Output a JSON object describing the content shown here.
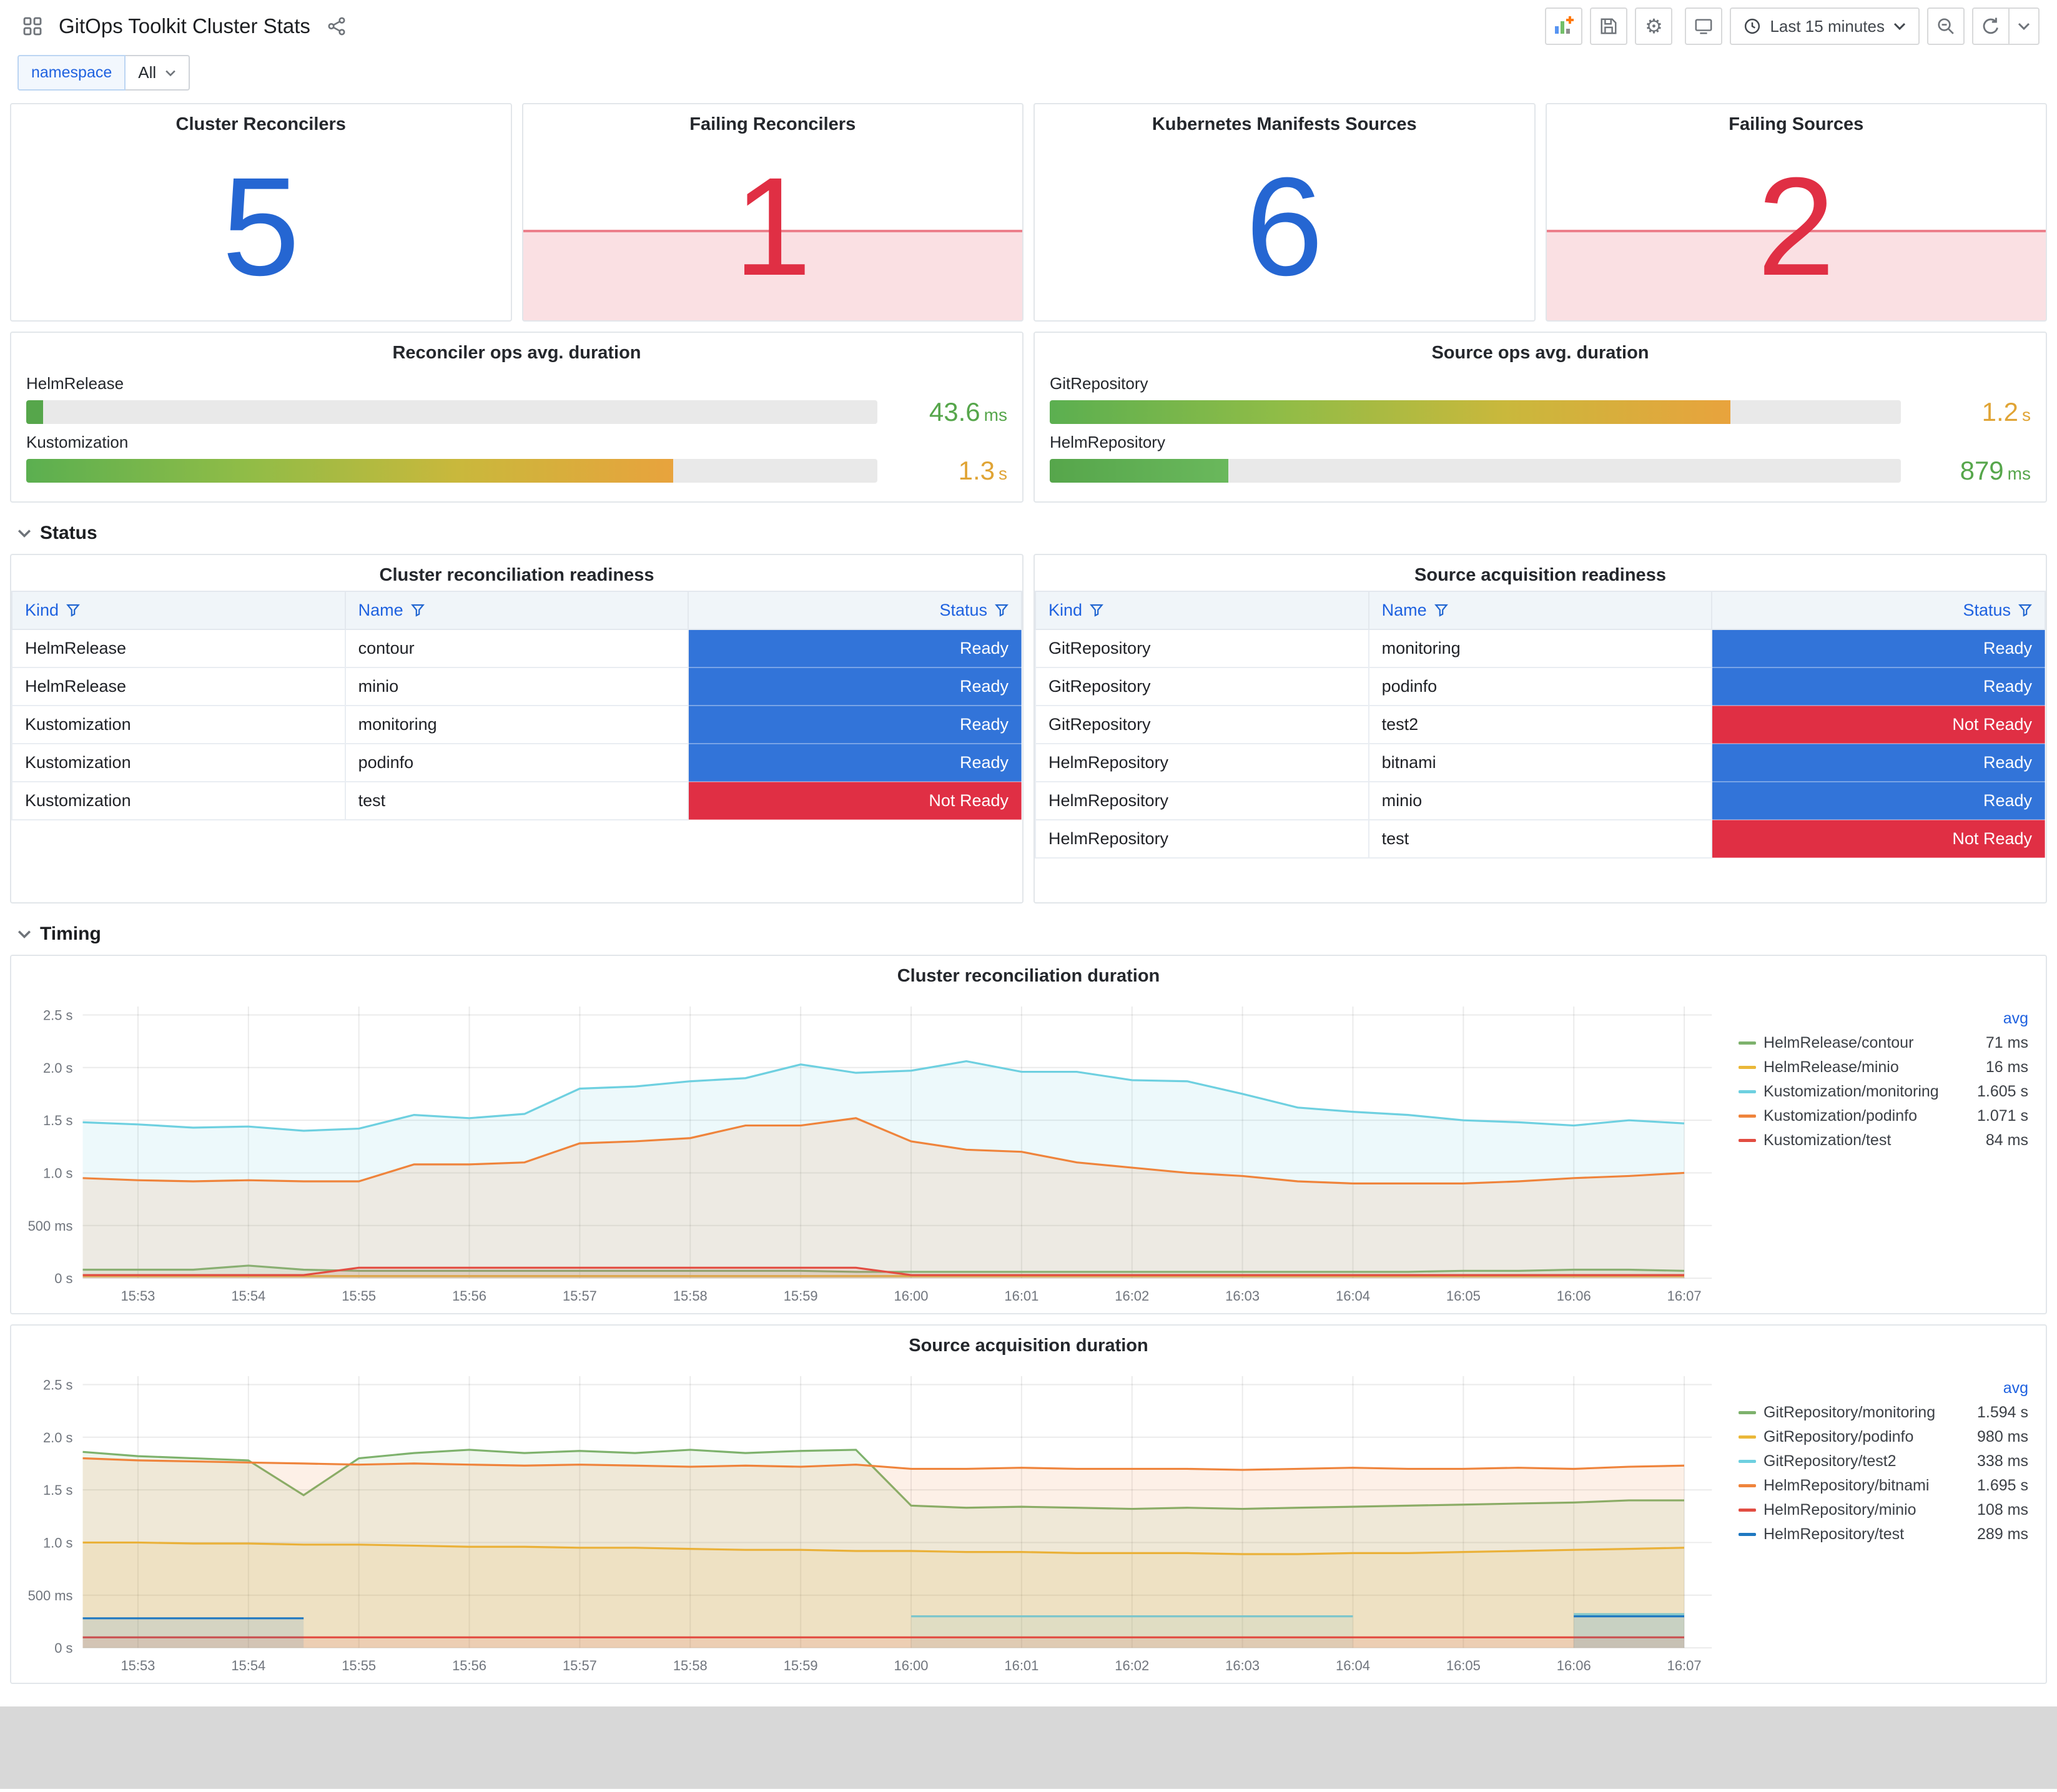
{
  "header": {
    "title": "GitOps Toolkit Cluster Stats",
    "time_range_label": "Last 15 minutes"
  },
  "variables": {
    "namespace_label": "namespace",
    "namespace_value": "All"
  },
  "stats": [
    {
      "title": "Cluster Reconcilers",
      "value": "5",
      "color": "#2566D2",
      "failing": false
    },
    {
      "title": "Failing Reconcilers",
      "value": "1",
      "color": "#E02F44",
      "failing": true
    },
    {
      "title": "Kubernetes Manifests Sources",
      "value": "6",
      "color": "#2566D2",
      "failing": false
    },
    {
      "title": "Failing Sources",
      "value": "2",
      "color": "#E02F44",
      "failing": true
    }
  ],
  "bar_gauges": [
    {
      "title": "Reconciler ops avg. duration",
      "rows": [
        {
          "label": "HelmRelease",
          "value": "43.6",
          "unit": "ms",
          "pct": 2,
          "value_color": "#56A64B",
          "bar_gradient": "linear-gradient(90deg,#56A64B,#56A64B)"
        },
        {
          "label": "Kustomization",
          "value": "1.3",
          "unit": "s",
          "pct": 76,
          "value_color": "#E0A435",
          "bar_gradient": "linear-gradient(90deg,#5BAF50,#8FBC47,#C9B83C,#E8A33D)"
        }
      ]
    },
    {
      "title": "Source ops avg. duration",
      "rows": [
        {
          "label": "GitRepository",
          "value": "1.2",
          "unit": "s",
          "pct": 80,
          "value_color": "#E0A435",
          "bar_gradient": "linear-gradient(90deg,#5BAF50,#8FBC47,#C9B83C,#E8A33D)"
        },
        {
          "label": "HelmRepository",
          "value": "879",
          "unit": "ms",
          "pct": 21,
          "value_color": "#56A64B",
          "bar_gradient": "linear-gradient(90deg,#56A64B,#6AB85C)"
        }
      ]
    }
  ],
  "sections": {
    "status": "Status",
    "timing": "Timing"
  },
  "status_colors": {
    "Ready": "#3274D9",
    "Not Ready": "#E02F44"
  },
  "tables": [
    {
      "title": "Cluster reconciliation readiness",
      "columns": [
        "Kind",
        "Name",
        "Status"
      ],
      "rows": [
        {
          "kind": "HelmRelease",
          "name": "contour",
          "status": "Ready"
        },
        {
          "kind": "HelmRelease",
          "name": "minio",
          "status": "Ready"
        },
        {
          "kind": "Kustomization",
          "name": "monitoring",
          "status": "Ready"
        },
        {
          "kind": "Kustomization",
          "name": "podinfo",
          "status": "Ready"
        },
        {
          "kind": "Kustomization",
          "name": "test",
          "status": "Not Ready"
        }
      ]
    },
    {
      "title": "Source acquisition readiness",
      "columns": [
        "Kind",
        "Name",
        "Status"
      ],
      "rows": [
        {
          "kind": "GitRepository",
          "name": "monitoring",
          "status": "Ready"
        },
        {
          "kind": "GitRepository",
          "name": "podinfo",
          "status": "Ready"
        },
        {
          "kind": "GitRepository",
          "name": "test2",
          "status": "Not Ready"
        },
        {
          "kind": "HelmRepository",
          "name": "bitnami",
          "status": "Ready"
        },
        {
          "kind": "HelmRepository",
          "name": "minio",
          "status": "Ready"
        },
        {
          "kind": "HelmRepository",
          "name": "test",
          "status": "Not Ready"
        }
      ]
    }
  ],
  "chart_data": [
    {
      "type": "line",
      "title": "Cluster reconciliation duration",
      "ylim": [
        0,
        2.5
      ],
      "y_tick_values": [
        0,
        0.5,
        1.0,
        1.5,
        2.0,
        2.5
      ],
      "y_ticks": [
        "0 s",
        "500 ms",
        "1.0 s",
        "1.5 s",
        "2.0 s",
        "2.5 s"
      ],
      "x_ticks": [
        "15:53",
        "15:54",
        "15:55",
        "15:56",
        "15:57",
        "15:58",
        "15:59",
        "16:00",
        "16:01",
        "16:02",
        "16:03",
        "16:04",
        "16:05",
        "16:06",
        "16:07"
      ],
      "x_step_minutes": 0.5,
      "legend_header": "avg",
      "grid": true,
      "legend_position": "right",
      "series": [
        {
          "name": "HelmRelease/contour",
          "avg": "71 ms",
          "color": "#7EB26D",
          "values": [
            0.08,
            0.08,
            0.08,
            0.12,
            0.08,
            0.07,
            0.07,
            0.07,
            0.07,
            0.07,
            0.07,
            0.07,
            0.07,
            0.07,
            0.06,
            0.06,
            0.06,
            0.06,
            0.06,
            0.06,
            0.06,
            0.06,
            0.06,
            0.06,
            0.06,
            0.07,
            0.07,
            0.08,
            0.08,
            0.07
          ]
        },
        {
          "name": "HelmRelease/minio",
          "avg": "16 ms",
          "color": "#EAB839",
          "values": [
            0.02,
            0.02,
            0.02,
            0.02,
            0.02,
            0.02,
            0.02,
            0.02,
            0.02,
            0.02,
            0.02,
            0.02,
            0.02,
            0.02,
            0.02,
            0.02,
            0.02,
            0.02,
            0.02,
            0.02,
            0.02,
            0.02,
            0.02,
            0.02,
            0.02,
            0.02,
            0.02,
            0.02,
            0.02,
            0.02
          ]
        },
        {
          "name": "Kustomization/monitoring",
          "avg": "1.605 s",
          "color": "#6ED0E0",
          "values": [
            1.48,
            1.46,
            1.43,
            1.44,
            1.4,
            1.42,
            1.55,
            1.52,
            1.56,
            1.8,
            1.82,
            1.87,
            1.9,
            2.03,
            1.95,
            1.97,
            2.06,
            1.96,
            1.96,
            1.88,
            1.87,
            1.75,
            1.62,
            1.58,
            1.55,
            1.5,
            1.48,
            1.45,
            1.5,
            1.47
          ]
        },
        {
          "name": "Kustomization/podinfo",
          "avg": "1.071 s",
          "color": "#EF843C",
          "values": [
            0.95,
            0.93,
            0.92,
            0.93,
            0.92,
            0.92,
            1.08,
            1.08,
            1.1,
            1.28,
            1.3,
            1.33,
            1.45,
            1.45,
            1.52,
            1.3,
            1.22,
            1.2,
            1.1,
            1.05,
            1.0,
            0.97,
            0.92,
            0.9,
            0.9,
            0.9,
            0.92,
            0.95,
            0.97,
            1.0
          ]
        },
        {
          "name": "Kustomization/test",
          "avg": "84 ms",
          "color": "#E24D42",
          "values": [
            0.03,
            0.03,
            0.03,
            0.03,
            0.03,
            0.1,
            0.1,
            0.1,
            0.1,
            0.1,
            0.1,
            0.1,
            0.1,
            0.1,
            0.1,
            0.03,
            0.03,
            0.03,
            0.03,
            0.03,
            0.03,
            0.03,
            0.03,
            0.03,
            0.03,
            0.03,
            0.03,
            0.03,
            0.03,
            0.03
          ]
        }
      ]
    },
    {
      "type": "line",
      "title": "Source acquisition duration",
      "ylim": [
        0,
        2.5
      ],
      "y_tick_values": [
        0,
        0.5,
        1.0,
        1.5,
        2.0,
        2.5
      ],
      "y_ticks": [
        "0 s",
        "500 ms",
        "1.0 s",
        "1.5 s",
        "2.0 s",
        "2.5 s"
      ],
      "x_ticks": [
        "15:53",
        "15:54",
        "15:55",
        "15:56",
        "15:57",
        "15:58",
        "15:59",
        "16:00",
        "16:01",
        "16:02",
        "16:03",
        "16:04",
        "16:05",
        "16:06",
        "16:07"
      ],
      "x_step_minutes": 0.5,
      "legend_header": "avg",
      "grid": true,
      "legend_position": "right",
      "series": [
        {
          "name": "GitRepository/monitoring",
          "avg": "1.594 s",
          "color": "#7EB26D",
          "values": [
            1.86,
            1.82,
            1.8,
            1.78,
            1.45,
            1.8,
            1.85,
            1.88,
            1.85,
            1.87,
            1.85,
            1.88,
            1.85,
            1.87,
            1.88,
            1.35,
            1.33,
            1.34,
            1.33,
            1.32,
            1.33,
            1.32,
            1.33,
            1.34,
            1.35,
            1.36,
            1.37,
            1.38,
            1.4,
            1.4
          ]
        },
        {
          "name": "GitRepository/podinfo",
          "avg": "980 ms",
          "color": "#EAB839",
          "values": [
            1.0,
            1.0,
            0.99,
            0.99,
            0.98,
            0.98,
            0.97,
            0.96,
            0.96,
            0.95,
            0.95,
            0.94,
            0.93,
            0.93,
            0.92,
            0.92,
            0.91,
            0.91,
            0.9,
            0.9,
            0.9,
            0.89,
            0.89,
            0.9,
            0.9,
            0.91,
            0.92,
            0.93,
            0.94,
            0.95
          ]
        },
        {
          "name": "GitRepository/test2",
          "avg": "338 ms",
          "color": "#6ED0E0",
          "values": [
            null,
            null,
            null,
            null,
            null,
            null,
            null,
            null,
            null,
            null,
            null,
            null,
            null,
            null,
            null,
            0.3,
            0.3,
            0.3,
            0.3,
            0.3,
            0.3,
            0.3,
            0.3,
            0.3,
            null,
            null,
            null,
            0.32,
            0.32,
            0.32
          ]
        },
        {
          "name": "HelmRepository/bitnami",
          "avg": "1.695 s",
          "color": "#EF843C",
          "values": [
            1.8,
            1.78,
            1.77,
            1.76,
            1.75,
            1.74,
            1.75,
            1.74,
            1.73,
            1.74,
            1.73,
            1.72,
            1.73,
            1.72,
            1.74,
            1.7,
            1.7,
            1.71,
            1.7,
            1.7,
            1.7,
            1.69,
            1.7,
            1.71,
            1.7,
            1.7,
            1.71,
            1.7,
            1.72,
            1.73
          ]
        },
        {
          "name": "HelmRepository/minio",
          "avg": "108 ms",
          "color": "#E24D42",
          "values": [
            0.1,
            0.1,
            0.1,
            0.1,
            0.1,
            0.1,
            0.1,
            0.1,
            0.1,
            0.1,
            0.1,
            0.1,
            0.1,
            0.1,
            0.1,
            0.1,
            0.1,
            0.1,
            0.1,
            0.1,
            0.1,
            0.1,
            0.1,
            0.1,
            0.1,
            0.1,
            0.1,
            0.1,
            0.1,
            0.1
          ]
        },
        {
          "name": "HelmRepository/test",
          "avg": "289 ms",
          "color": "#1F78C1",
          "values": [
            0.28,
            0.28,
            0.28,
            0.28,
            0.28,
            null,
            null,
            null,
            null,
            null,
            null,
            null,
            null,
            null,
            null,
            null,
            null,
            null,
            null,
            null,
            null,
            null,
            null,
            null,
            null,
            null,
            null,
            0.3,
            0.3,
            0.3
          ]
        }
      ]
    }
  ]
}
